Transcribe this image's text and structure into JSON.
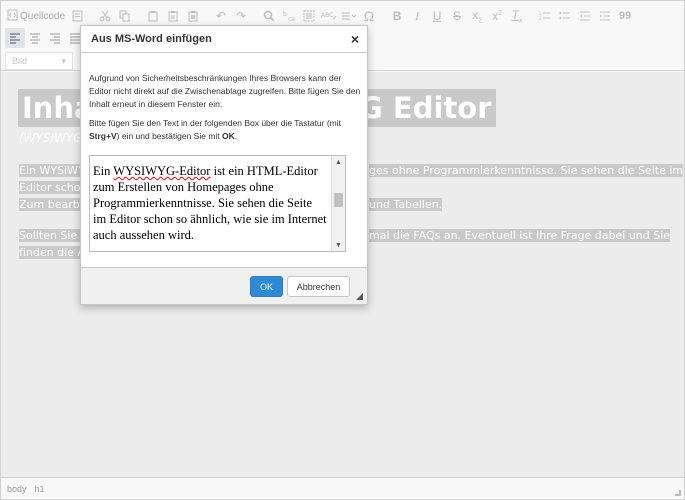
{
  "toolbar": {
    "source_label": "Quellcode",
    "format_select": "Bild",
    "special_char": "Ω",
    "quote": "99"
  },
  "content": {
    "heading_left": "Inhal",
    "heading_right": "G Editor",
    "subtitle": "(WYSIWYG =",
    "p1_left_1": "Ein WYSIWY",
    "p1_right_1": "ges ohne Programmierkenntnisse. Sie sehen die Seite im",
    "p1_left_2": "Editor scho",
    "p1_left_3": "Zum bearbe",
    "p1_right_3": "und Tabellen.",
    "p2_left_1": "Sollten Sie F",
    "p2_right_1": "mal die FAQs an. Eventuell ist Ihre Frage dabei und Sie",
    "p2_left_2": "finden die A"
  },
  "statusbar": {
    "path_1": "body",
    "path_2": "h1"
  },
  "dialog": {
    "title": "Aus MS-Word einfügen",
    "close_symbol": "×",
    "message_1": "Aufgrund von Sicherheitsbeschränkungen Ihres Browsers kann der Editor nicht direkt auf die Zwischenablage zugreifen. Bitte fügen Sie den Inhalt erneut in diesem Fenster ein.",
    "message_2_pre": "Bitte fügen Sie den Text in der folgenden Box über die Tastatur (mit ",
    "message_2_key": "Strg+V",
    "message_2_mid": ") ein und bestätigen Sie mit ",
    "message_2_ok": "OK",
    "message_2_end": ".",
    "paste_text_pre": "Ein ",
    "paste_text_misspelled": "WYSIWYG-Editor",
    "paste_text_post": " ist ein HTML-Editor zum Erstellen von Homepages ohne Programmierkenntnisse. Sie sehen die Seite im Editor schon so ähnlich, wie sie im Internet auch aussehen wird.",
    "ok_label": "OK",
    "cancel_label": "Abbrechen"
  }
}
